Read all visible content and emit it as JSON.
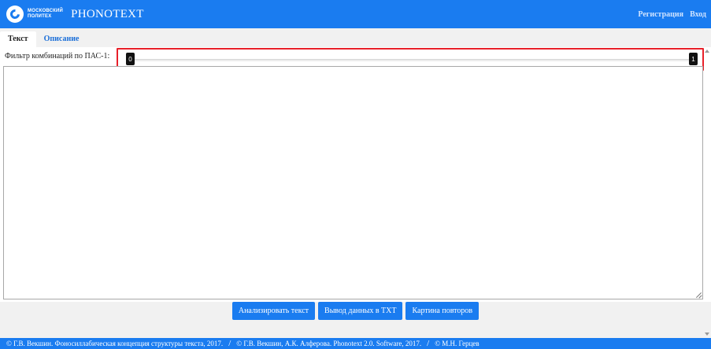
{
  "navbar": {
    "logo_line1": "Московский",
    "logo_line2": "Политех",
    "brand": "PHONOTEXT",
    "register": "Регистрация",
    "login": "Вход"
  },
  "tabs": [
    {
      "label": "Текст",
      "active": true
    },
    {
      "label": "Описание",
      "active": false
    }
  ],
  "filter": {
    "label": "Фильтр комбинаций по ПАС-1:",
    "min_value": "0",
    "max_value": "1"
  },
  "text_input": {
    "value": ""
  },
  "buttons": {
    "analyze": "Анализировать текст",
    "export_txt": "Вывод данных в TXT",
    "repeat_picture": "Картина повторов"
  },
  "footer": {
    "credit1": "© Г.В. Векшин. Фоносиллабическая концепция структуры текста, 2017.",
    "sep": "/",
    "credit2": "© Г.В. Векшин, А.К. Алферова. Phonotext 2.0. Software, 2017.",
    "credit3": "© М.Н. Герцев"
  },
  "colors": {
    "accent": "#1a7cf0",
    "highlight": "#e8202a"
  }
}
